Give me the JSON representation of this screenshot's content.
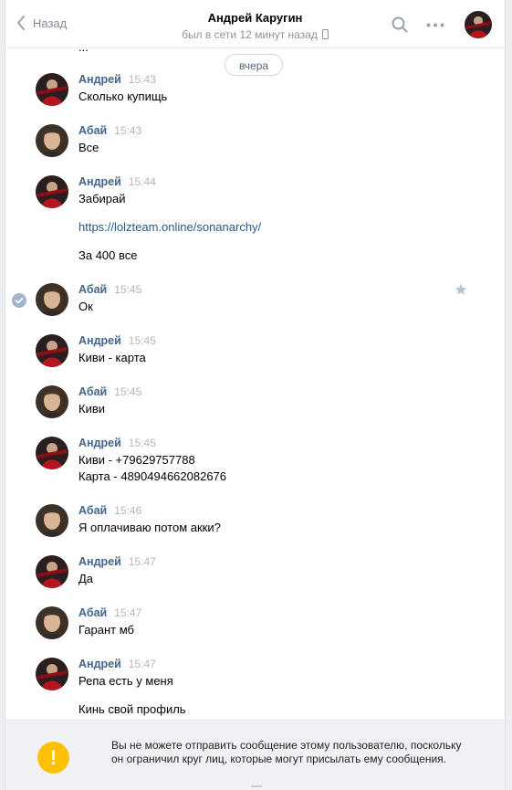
{
  "header": {
    "back_label": "Назад",
    "title": "Андрей Каругин",
    "status": "был в сети 12 минут назад"
  },
  "date_separator": "вчера",
  "partial_prev_text": "...",
  "messages": [
    {
      "author": "Андрей",
      "time": "15:43",
      "lines": [
        "Сколько купищь"
      ]
    },
    {
      "author": "Абай",
      "time": "15:43",
      "lines": [
        "Все"
      ]
    },
    {
      "author": "Андрей",
      "time": "15:44",
      "lines": [
        "Забирай",
        "",
        "https://lolzteam.online/sonanarchy/",
        "",
        "За 400 все"
      ]
    },
    {
      "author": "Абай",
      "time": "15:45",
      "lines": [
        "Ок"
      ]
    },
    {
      "author": "Андрей",
      "time": "15:45",
      "lines": [
        "Киви - карта"
      ]
    },
    {
      "author": "Абай",
      "time": "15:45",
      "lines": [
        "Киви"
      ]
    },
    {
      "author": "Андрей",
      "time": "15:45",
      "lines": [
        "Киви - +79629757788",
        "Карта - 4890494662082676"
      ]
    },
    {
      "author": "Абай",
      "time": "15:46",
      "lines": [
        "Я оплачиваю потом акки?"
      ]
    },
    {
      "author": "Андрей",
      "time": "15:47",
      "lines": [
        "Да"
      ]
    },
    {
      "author": "Абай",
      "time": "15:47",
      "lines": [
        "Гарант мб"
      ]
    },
    {
      "author": "Андрей",
      "time": "15:47",
      "lines": [
        "Репа есть у меня",
        "",
        "Кинь свой профиль"
      ]
    }
  ],
  "notice": {
    "icon": "!",
    "text": "Вы не можете отправить сообщение этому пользователю, поскольку он ограничил круг лиц, которые могут присылать ему сообщения."
  },
  "colors": {
    "author_name": "#42648b",
    "link": "#2a5885",
    "time": "#adb7c1",
    "warning": "#ffc107"
  }
}
